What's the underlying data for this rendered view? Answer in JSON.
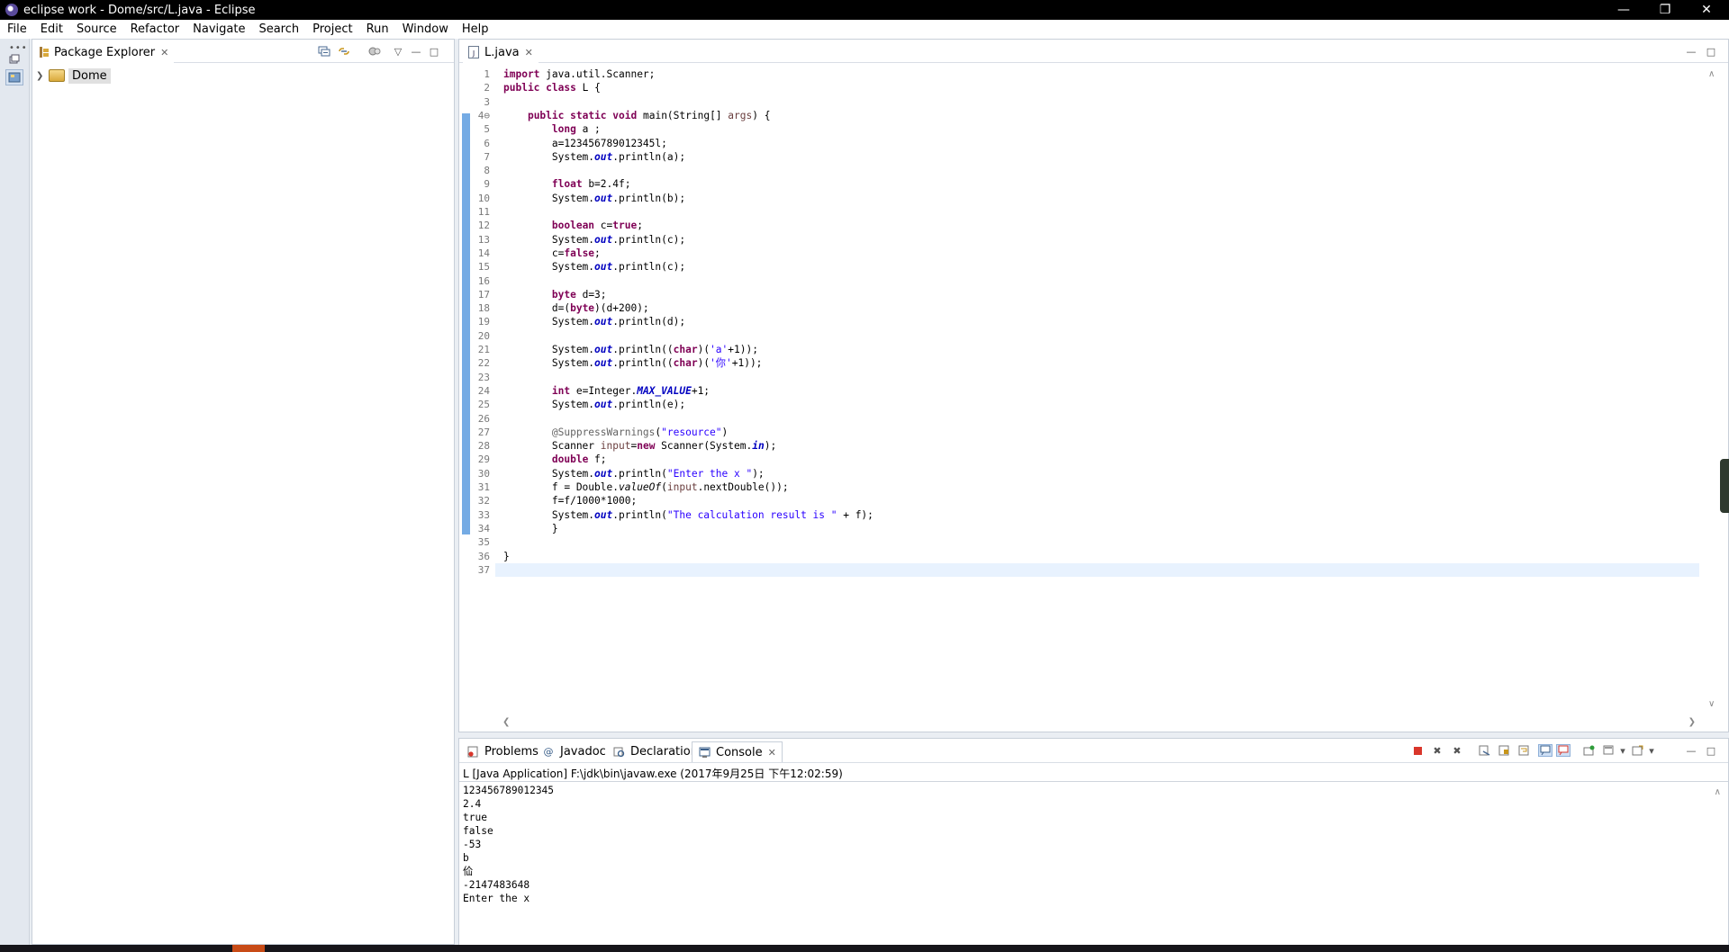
{
  "window": {
    "title": "eclipse work - Dome/src/L.java - Eclipse"
  },
  "menu": [
    "File",
    "Edit",
    "Source",
    "Refactor",
    "Navigate",
    "Search",
    "Project",
    "Run",
    "Window",
    "Help"
  ],
  "package_explorer": {
    "tab_label": "Package Explorer",
    "project": "Dome"
  },
  "editor": {
    "tab_label": "L.java",
    "current_line": 37,
    "lines": [
      "import java.util.Scanner;",
      "public class L {",
      "",
      "    public static void main(String[] args) {",
      "        long a ;",
      "        a=123456789012345l;",
      "        System.out.println(a);",
      "",
      "        float b=2.4f;",
      "        System.out.println(b);",
      "",
      "        boolean c=true;",
      "        System.out.println(c);",
      "        c=false;",
      "        System.out.println(c);",
      "",
      "        byte d=3;",
      "        d=(byte)(d+200);",
      "        System.out.println(d);",
      "",
      "        System.out.println((char)('a'+1));",
      "        System.out.println((char)('你'+1));",
      "",
      "        int e=Integer.MAX_VALUE+1;",
      "        System.out.println(e);",
      "",
      "        @SuppressWarnings(\"resource\")",
      "        Scanner input=new Scanner(System.in);",
      "        double f;",
      "        System.out.println(\"Enter the x \");",
      "        f = Double.valueOf(input.nextDouble());",
      "        f=f/1000*1000;",
      "        System.out.println(\"The calculation result is \" + f);",
      "        }",
      "",
      "}",
      ""
    ]
  },
  "console": {
    "tabs": [
      {
        "label": "Problems",
        "icon": "problems-icon"
      },
      {
        "label": "Javadoc",
        "icon": "javadoc-icon"
      },
      {
        "label": "Declaration",
        "icon": "declaration-icon"
      },
      {
        "label": "Console",
        "icon": "console-icon"
      }
    ],
    "active_tab": "Console",
    "launch": "L [Java Application] F:\\jdk\\bin\\javaw.exe (2017年9月25日 下午12:02:59)",
    "output": [
      "123456789012345",
      "2.4",
      "true",
      "false",
      "-53",
      "b",
      "佡",
      "-2147483648",
      "Enter the x "
    ]
  },
  "colors": {
    "keyword": "#7f0055",
    "string": "#2a00ff",
    "field": "#0000c0",
    "change_bar": "#5d9cdf",
    "current_line": "#e8f2fe"
  }
}
